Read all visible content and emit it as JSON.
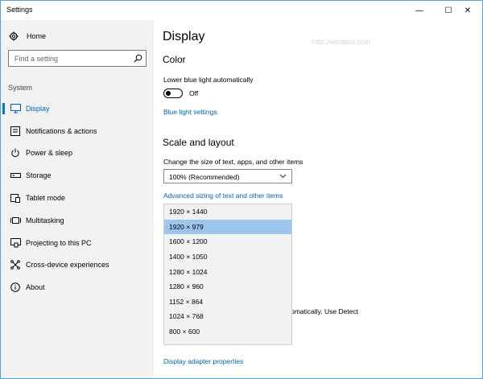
{
  "window": {
    "title": "Settings",
    "controls": {
      "minimize": "—",
      "maximize": "☐",
      "close": "✕"
    }
  },
  "sidebar": {
    "home_label": "Home",
    "search_placeholder": "Find a setting",
    "section_label": "System",
    "items": [
      {
        "label": "Display",
        "icon": "display-icon",
        "active": true
      },
      {
        "label": "Notifications & actions",
        "icon": "notifications-icon",
        "active": false
      },
      {
        "label": "Power & sleep",
        "icon": "power-icon",
        "active": false
      },
      {
        "label": "Storage",
        "icon": "storage-icon",
        "active": false
      },
      {
        "label": "Tablet mode",
        "icon": "tablet-mode-icon",
        "active": false
      },
      {
        "label": "Multitasking",
        "icon": "multitasking-icon",
        "active": false
      },
      {
        "label": "Projecting to this PC",
        "icon": "projecting-icon",
        "active": false
      },
      {
        "label": "Cross-device experiences",
        "icon": "cross-device-icon",
        "active": false
      },
      {
        "label": "About",
        "icon": "about-icon",
        "active": false
      }
    ]
  },
  "main": {
    "page_title": "Display",
    "color": {
      "heading": "Color",
      "lower_blue_label": "Lower blue light automatically",
      "toggle_state": "Off",
      "blue_light_link": "Blue light settings"
    },
    "scale": {
      "heading": "Scale and layout",
      "change_size_label": "Change the size of text, apps, and other items",
      "scale_value": "100% (Recommended)",
      "advanced_link": "Advanced sizing of text and other items"
    },
    "resolution_options": [
      "1920 × 1440",
      "1920 × 979",
      "1600 × 1200",
      "1400 × 1050",
      "1280 × 1024",
      "1280 × 960",
      "1152 × 864",
      "1024 × 768",
      "800 × 600"
    ],
    "resolution_selected_index": 1,
    "obscured_text": "utomatically. Use Detect",
    "adapter_link": "Display adapter properties"
  },
  "watermark_text": "http://winaero.com",
  "colors": {
    "accent": "#0078d7",
    "link": "#0063b1",
    "sidebar_bg": "#f2f2f2",
    "selected": "#9cc6ed"
  }
}
